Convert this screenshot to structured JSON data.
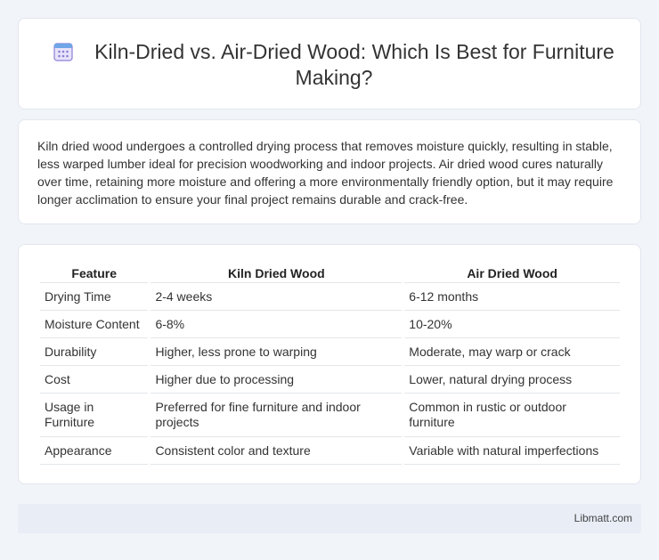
{
  "header": {
    "icon": "calendar-icon",
    "title": "Kiln-Dried vs. Air-Dried Wood: Which Is Best for Furniture Making?"
  },
  "intro": {
    "text": "Kiln dried wood undergoes a controlled drying process that removes moisture quickly, resulting in stable, less warped lumber ideal for precision woodworking and indoor projects. Air dried wood cures naturally over time, retaining more moisture and offering a more environmentally friendly option, but it may require longer acclimation to ensure your final project remains durable and crack-free."
  },
  "table": {
    "headers": [
      "Feature",
      "Kiln Dried Wood",
      "Air Dried Wood"
    ],
    "rows": [
      [
        "Drying Time",
        "2-4 weeks",
        "6-12 months"
      ],
      [
        "Moisture Content",
        "6-8%",
        "10-20%"
      ],
      [
        "Durability",
        "Higher, less prone to warping",
        "Moderate, may warp or crack"
      ],
      [
        "Cost",
        "Higher due to processing",
        "Lower, natural drying process"
      ],
      [
        "Usage in Furniture",
        "Preferred for fine furniture and indoor projects",
        "Common in rustic or outdoor furniture"
      ],
      [
        "Appearance",
        "Consistent color and texture",
        "Variable with natural imperfections"
      ]
    ]
  },
  "footer": {
    "text": "Libmatt.com"
  },
  "colors": {
    "background": "#f1f4f9",
    "card": "#ffffff",
    "footer": "#e8edf6",
    "icon_accent": "#8b7fd6"
  }
}
